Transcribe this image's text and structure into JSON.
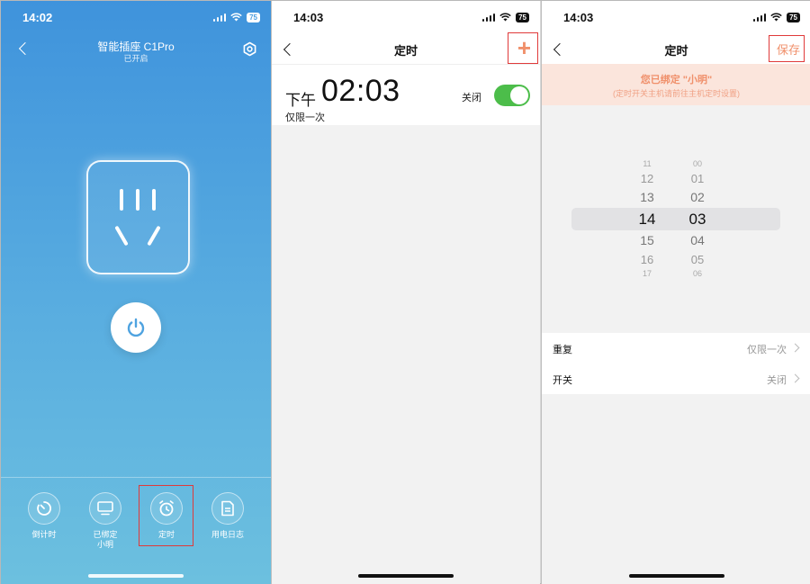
{
  "panel1": {
    "status_time": "14:02",
    "battery": "75",
    "title": "智能插座 C1Pro",
    "subtitle": "已开启",
    "tools": [
      {
        "label": "倒计时",
        "icon": "countdown-icon"
      },
      {
        "label": "已绑定\n小明",
        "icon": "monitor-icon"
      },
      {
        "label": "定时",
        "icon": "alarm-clock-icon"
      },
      {
        "label": "用电日志",
        "icon": "document-icon"
      }
    ]
  },
  "panel2": {
    "status_time": "14:03",
    "battery": "75",
    "title": "定时",
    "add_label": "+",
    "timer": {
      "period": "下午",
      "time": "02:03",
      "repeat": "仅限一次",
      "switch_label": "关闭",
      "enabled": true
    }
  },
  "panel3": {
    "status_time": "14:03",
    "battery": "75",
    "title": "定时",
    "save_label": "保存",
    "notice_title": "您已绑定 \"小明\"",
    "notice_sub": "(定时开关主机请前往主机定时设置)",
    "hours": [
      "11",
      "12",
      "13",
      "14",
      "15",
      "16",
      "17"
    ],
    "minutes": [
      "00",
      "01",
      "02",
      "03",
      "04",
      "05",
      "06"
    ],
    "rows": [
      {
        "label": "重复",
        "value": "仅限一次"
      },
      {
        "label": "开关",
        "value": "关闭"
      }
    ]
  },
  "colors": {
    "accent_orange": "#f0906b",
    "toggle_green": "#4cbd4a",
    "highlight_red": "#e03a3a",
    "brand_blue": "#4fa3e0"
  }
}
